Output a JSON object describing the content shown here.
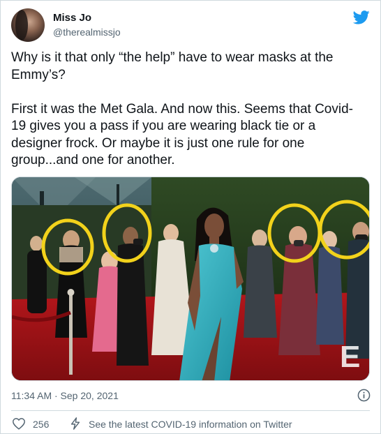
{
  "tweet": {
    "author_name": "Miss Jo",
    "author_handle": "@therealmissjo",
    "text": "Why is it that only “the help” have to wear masks at the Emmy’s?\n\nFirst it was the Met Gala. And now this. Seems that Covid-19 gives you a pass if you are wearing black tie or a designer frock. Or maybe it is just one rule for one group...and one for another.",
    "timestamp": "11:34 AM · Sep 20, 2021",
    "like_count": "256",
    "covid_link": "See the latest COVID-19 information on Twitter"
  },
  "media": {
    "watermark": "E"
  },
  "icons": {
    "brand": "twitter-bird-icon",
    "info": "info-icon",
    "like": "heart-icon",
    "covid": "lightning-bolt-icon"
  },
  "colors": {
    "brand_blue": "#1d9bf0",
    "secondary_text": "#536471",
    "circle_highlight": "#f2d21b"
  }
}
